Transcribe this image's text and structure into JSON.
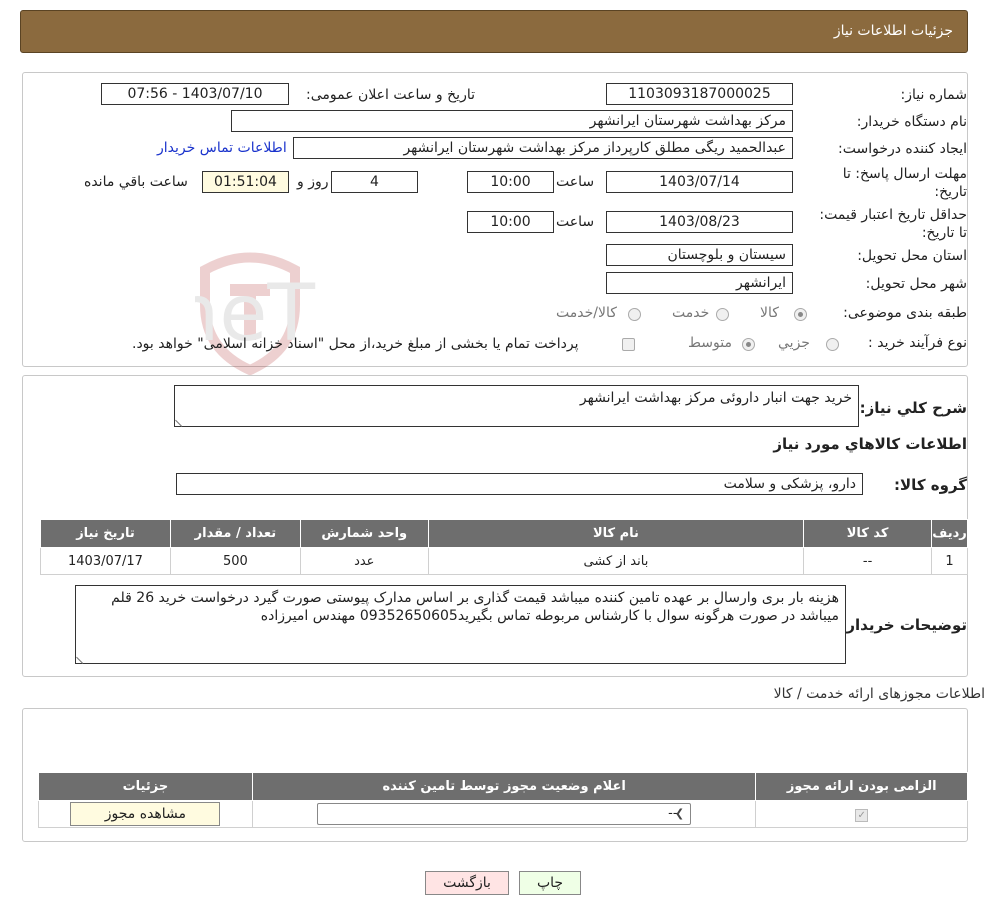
{
  "page_title": "جزئیات اطلاعات نیاز",
  "fields": {
    "need_number_label": "شماره نیاز:",
    "need_number": "1103093187000025",
    "announce_label": "تاریخ و ساعت اعلان عمومی:",
    "announce_value": "1403/07/10 - 07:56",
    "buyer_org_label": "نام دستگاه خریدار:",
    "buyer_org": "مرکز بهداشت شهرستان ایرانشهر",
    "creator_label": "ایجاد کننده درخواست:",
    "creator": "عبدالحمید ریگی مطلق کارپرداز مرکز بهداشت شهرستان ایرانشهر",
    "buyer_contact_link": "اطلاعات تماس خریدار",
    "reply_deadline_label": "مهلت ارسال پاسخ: تا تاریخ:",
    "reply_date": "1403/07/14",
    "time_label": "ساعت",
    "reply_time": "10:00",
    "days_value": "4",
    "days_label": "روز و",
    "remaining_time": "01:51:04",
    "remaining_label": "ساعت باقي مانده",
    "price_validity_label": "حداقل تاریخ اعتبار قیمت: تا تاریخ:",
    "price_validity_date": "1403/08/23",
    "price_validity_time": "10:00",
    "province_label": "استان محل تحویل:",
    "province": "سیستان و بلوچستان",
    "city_label": "شهر محل تحویل:",
    "city": "ایرانشهر",
    "category_label": "طبقه بندی موضوعی:",
    "category_options": [
      "کالا",
      "خدمت",
      "کالا/خدمت"
    ],
    "process_label": "نوع فرآیند خرید :",
    "process_options": [
      "جزیي",
      "متوسط"
    ],
    "process_note": "پرداخت تمام یا بخشی از مبلغ خرید،از محل \"اسناد خزانه اسلامی\" خواهد بود."
  },
  "summary": {
    "label": "شرح کلي نياز:",
    "value": "خرید جهت انبار داروئی مرکز بهداشت ایرانشهر",
    "goods_heading": "اطلاعات کالاهاي مورد نياز",
    "group_label": "گروه کالا:",
    "group_value": "دارو، پزشکی و سلامت"
  },
  "goods_table": {
    "headers": [
      "رديف",
      "کد کالا",
      "نام کالا",
      "واحد شمارش",
      "تعداد / مقدار",
      "تاریخ نیاز"
    ],
    "rows": [
      [
        "1",
        "--",
        "باند از کشی",
        "عدد",
        "500",
        "1403/07/17"
      ]
    ]
  },
  "buyer_notes": {
    "label": "توضيحات خريدار:",
    "value": "هزینه بار بری وارسال بر عهده تامین کننده میباشد قیمت گذاری بر اساس مدارک پیوستی صورت گیرد درخواست خرید 26 قلم میباشد در صورت هرگونه سوال با کارشناس مربوطه تماس بگیرید09352650605 مهندس امیرزاده"
  },
  "licenses": {
    "heading": "اطلاعات مجوزهای ارائه خدمت / کالا",
    "headers": [
      "الزامی بودن ارائه مجوز",
      "اعلام وضعیت مجوز توسط تامین کننده",
      "جزئیات"
    ],
    "select_value": "--",
    "view_button": "مشاهده مجوز"
  },
  "buttons": {
    "print": "چاپ",
    "back": "بازگشت"
  },
  "watermark_text": "AriaTender.neT"
}
